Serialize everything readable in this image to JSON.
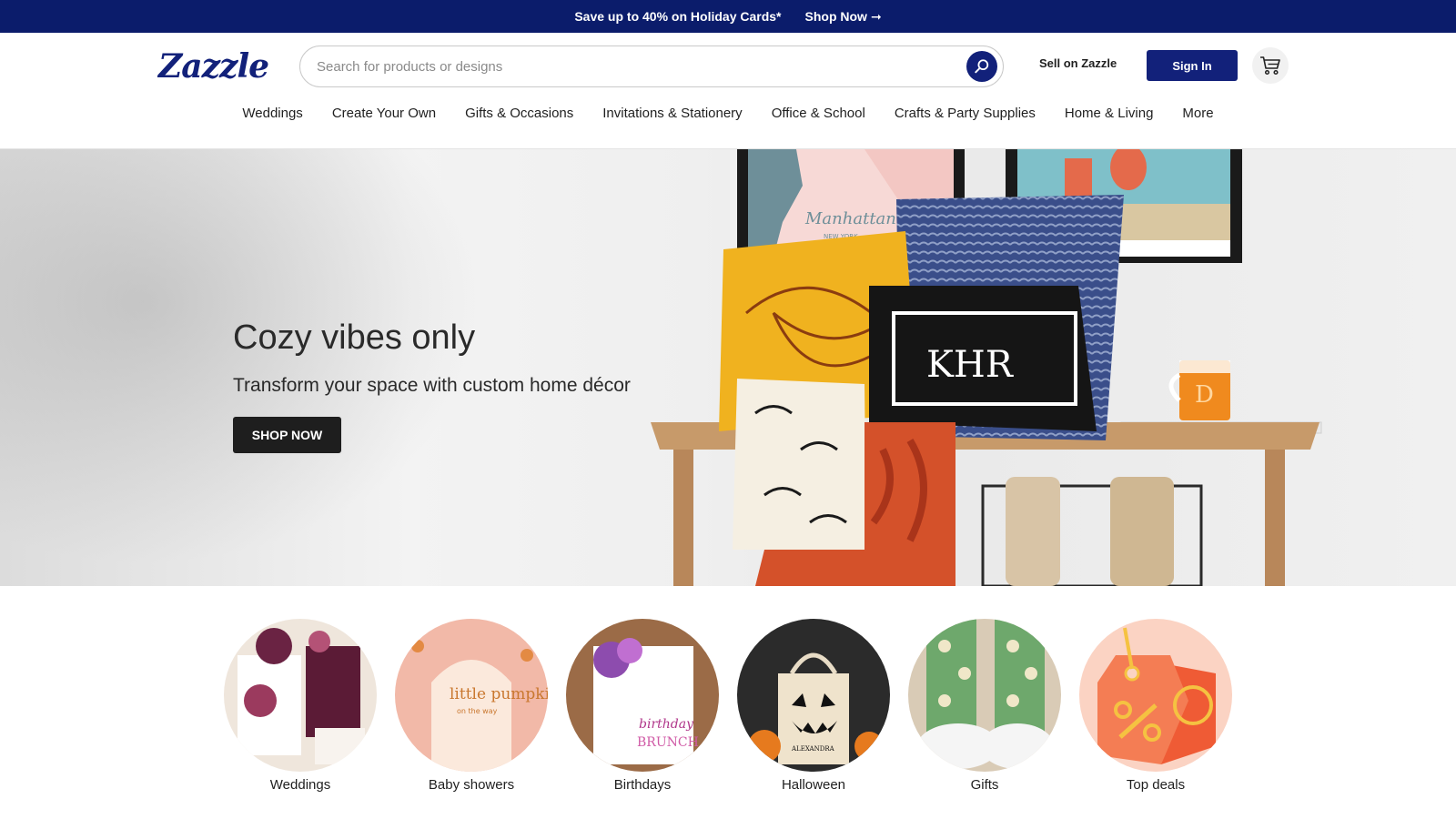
{
  "promo": {
    "text": "Save up to 40% on Holiday Cards*",
    "link_label": "Shop Now",
    "link_arrow": "➞"
  },
  "header": {
    "logo": "Zazzle",
    "search_placeholder": "Search for products or designs",
    "sell_label": "Sell on Zazzle",
    "signin_label": "Sign In"
  },
  "nav": [
    {
      "label": "Weddings"
    },
    {
      "label": "Create Your Own"
    },
    {
      "label": "Gifts & Occasions"
    },
    {
      "label": "Invitations & Stationery"
    },
    {
      "label": "Office & School"
    },
    {
      "label": "Crafts & Party Supplies"
    },
    {
      "label": "Home & Living"
    },
    {
      "label": "More"
    }
  ],
  "hero": {
    "title": "Cozy vibes only",
    "subtitle": "Transform your space with custom home décor",
    "button_label": "SHOP NOW",
    "art_texts": {
      "map_city": "Manhattan",
      "map_sub": "NEW YORK",
      "pillow_monogram": "KHR",
      "mug_letter": "D"
    }
  },
  "categories": [
    {
      "label": "Weddings",
      "icon": "wedding-invitation-image"
    },
    {
      "label": "Baby showers",
      "icon": "baby-shower-invitation-image",
      "art_text": "little pumpkin",
      "art_sub": "on the way"
    },
    {
      "label": "Birthdays",
      "icon": "birthday-sign-image",
      "art_text": "birthday",
      "art_sub": "BRUNCH"
    },
    {
      "label": "Halloween",
      "icon": "halloween-tote-image",
      "art_text": "ALEXANDRA"
    },
    {
      "label": "Gifts",
      "icon": "gift-socks-image"
    },
    {
      "label": "Top deals",
      "icon": "sale-tag-icon"
    }
  ],
  "colors": {
    "brand_navy": "#12217a",
    "promo_bg": "#0b1c6b",
    "hero_button": "#1e1e1e"
  }
}
